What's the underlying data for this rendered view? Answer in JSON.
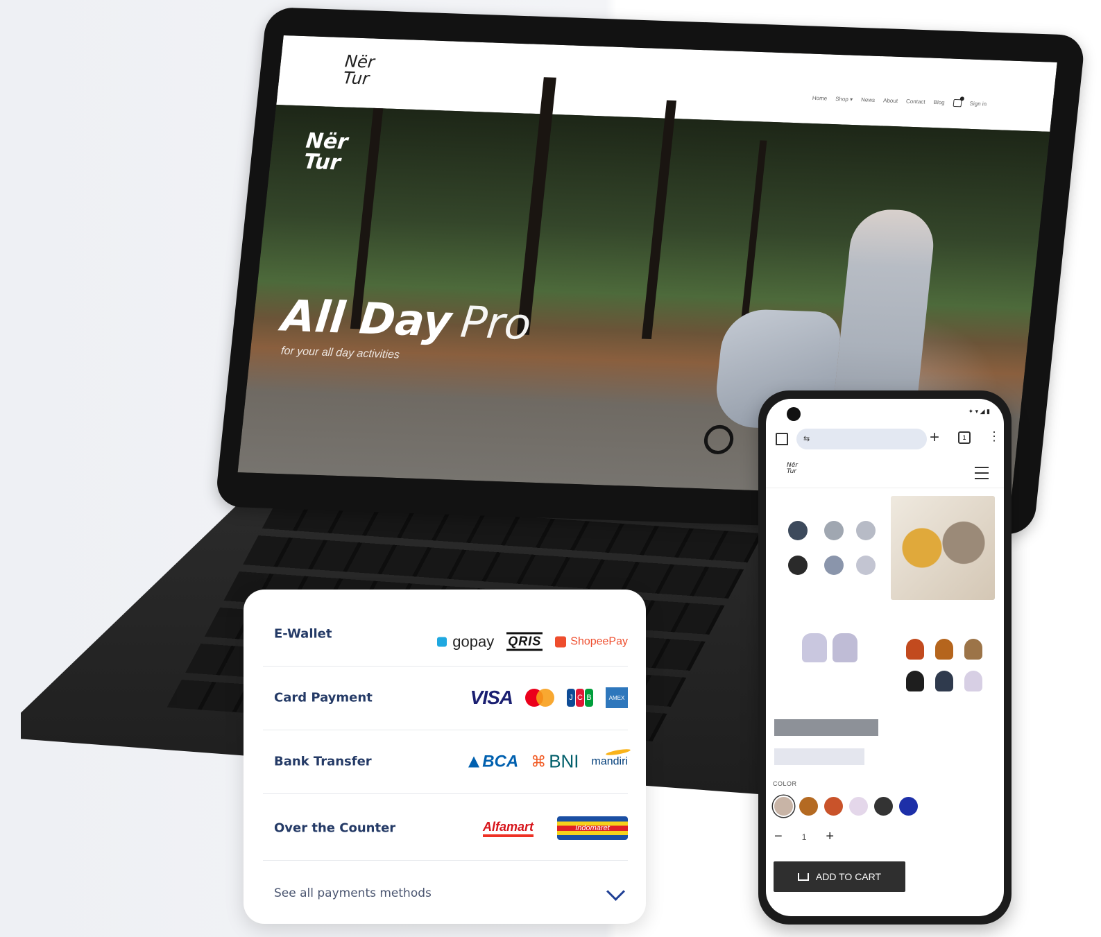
{
  "laptop": {
    "site": {
      "logo_line1": "Nër",
      "logo_line2": "Tur",
      "nav": [
        "Home",
        "Shop ▾",
        "News",
        "About",
        "Contact",
        "Blog"
      ],
      "sign_in": "Sign in"
    },
    "hero": {
      "logo_line1": "Nër",
      "logo_line2": "Tur",
      "title_bold": "All Day",
      "title_light": "Pro",
      "subtitle": "for your all day activities"
    }
  },
  "payments": {
    "rows": [
      {
        "label": "E-Wallet",
        "logos": [
          "gopay",
          "QRIS",
          "ShopeePay"
        ]
      },
      {
        "label": "Card Payment",
        "logos": [
          "VISA",
          "mastercard",
          "JCB",
          "AMEX"
        ]
      },
      {
        "label": "Bank Transfer",
        "logos": [
          "BCA",
          "BNI",
          "mandiri"
        ]
      },
      {
        "label": "Over the Counter",
        "logos": [
          "Alfamart",
          "Indomaret"
        ]
      }
    ],
    "see_all": "See all payments methods",
    "colors": {
      "label": "#243a66",
      "link": "#4a5570",
      "chevron": "#1f3f95"
    }
  },
  "phone": {
    "browser": {
      "tabs_count": "1"
    },
    "site": {
      "logo_line1": "Nër",
      "logo_line2": "Tur"
    },
    "product": {
      "color_label": "COLOR",
      "colors": [
        "#c8b4a6",
        "#b46a22",
        "#c9532a",
        "#e4d7ea",
        "#333333",
        "#1d2fa8"
      ],
      "quantity": "1",
      "minus": "−",
      "plus": "+",
      "add_to_cart": "ADD TO CART"
    }
  }
}
